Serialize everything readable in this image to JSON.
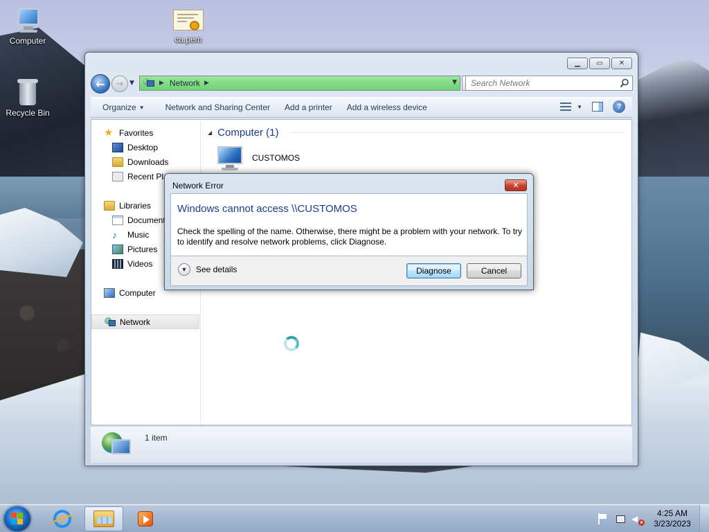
{
  "desktop": {
    "icons": [
      {
        "label": "Computer"
      },
      {
        "label": "ca.pem"
      },
      {
        "label": "Recycle Bin"
      }
    ]
  },
  "window": {
    "address": {
      "location": "Network"
    },
    "search": {
      "placeholder": "Search Network"
    },
    "toolbar": {
      "organize": "Organize",
      "network_sharing": "Network and Sharing Center",
      "add_printer": "Add a printer",
      "add_wireless": "Add a wireless device"
    },
    "nav_pane": {
      "favorites": "Favorites",
      "desktop": "Desktop",
      "downloads": "Downloads",
      "recent": "Recent Places",
      "libraries": "Libraries",
      "documents": "Documents",
      "music": "Music",
      "pictures": "Pictures",
      "videos": "Videos",
      "computer": "Computer",
      "network": "Network"
    },
    "main": {
      "group_header": "Computer (1)",
      "items": [
        {
          "name": "CUSTOMOS"
        }
      ]
    },
    "details": {
      "count": "1 item"
    }
  },
  "dialog": {
    "title": "Network Error",
    "heading": "Windows cannot access \\\\CUSTOMOS",
    "message": "Check the spelling of the name. Otherwise, there might be a problem with your network. To try to identify and resolve network problems, click Diagnose.",
    "see_details": "See details",
    "diagnose": "Diagnose",
    "cancel": "Cancel"
  },
  "taskbar": {
    "time": "4:25 AM",
    "date": "3/23/2023"
  },
  "colors": {
    "address_bar": "#6ed172",
    "dialog_heading": "#1a3e8e",
    "group_heading": "#1e3a8a",
    "close_button": "#c7402c"
  }
}
